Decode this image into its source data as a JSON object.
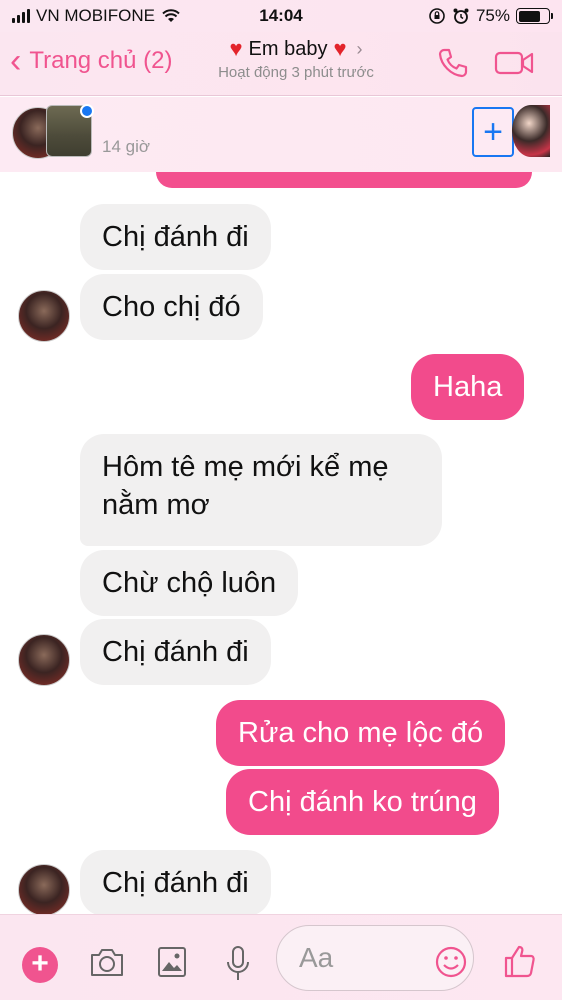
{
  "status_bar": {
    "carrier": "VN MOBIFONE",
    "time": "14:04",
    "battery": "75%",
    "battery_level": 0.75
  },
  "header": {
    "back_label": "Trang chủ (2)",
    "contact_name": "Em baby",
    "status": "Hoạt động 3 phút trước",
    "accent_color": "#f0548f"
  },
  "stories": {
    "time_label": "14 giờ"
  },
  "messages": [
    {
      "side": "in",
      "text": "Chị đánh đi"
    },
    {
      "side": "in",
      "text": "Cho chị đó"
    },
    {
      "side": "out",
      "text": "Haha"
    },
    {
      "side": "in",
      "text": "Hôm tê mẹ mới kể mẹ"
    },
    {
      "side": "in",
      "text": "nằm mơ"
    },
    {
      "side": "in",
      "text": "Chừ chộ luôn"
    },
    {
      "side": "in",
      "text": "Chị đánh đi"
    },
    {
      "side": "out",
      "text": "Rửa cho mẹ lộc đó"
    },
    {
      "side": "out",
      "text": "Chị đánh ko trúng"
    },
    {
      "side": "in",
      "text": "Chị đánh đi"
    }
  ],
  "composer": {
    "placeholder": "Aa",
    "icons": [
      "plus-icon",
      "camera-icon",
      "image-icon",
      "microphone-icon",
      "emoji-icon",
      "like-icon"
    ]
  },
  "colors": {
    "outgoing_bubble": "#f24b8c",
    "incoming_bubble": "#f1f0f0",
    "online_dot": "#1877f2"
  }
}
